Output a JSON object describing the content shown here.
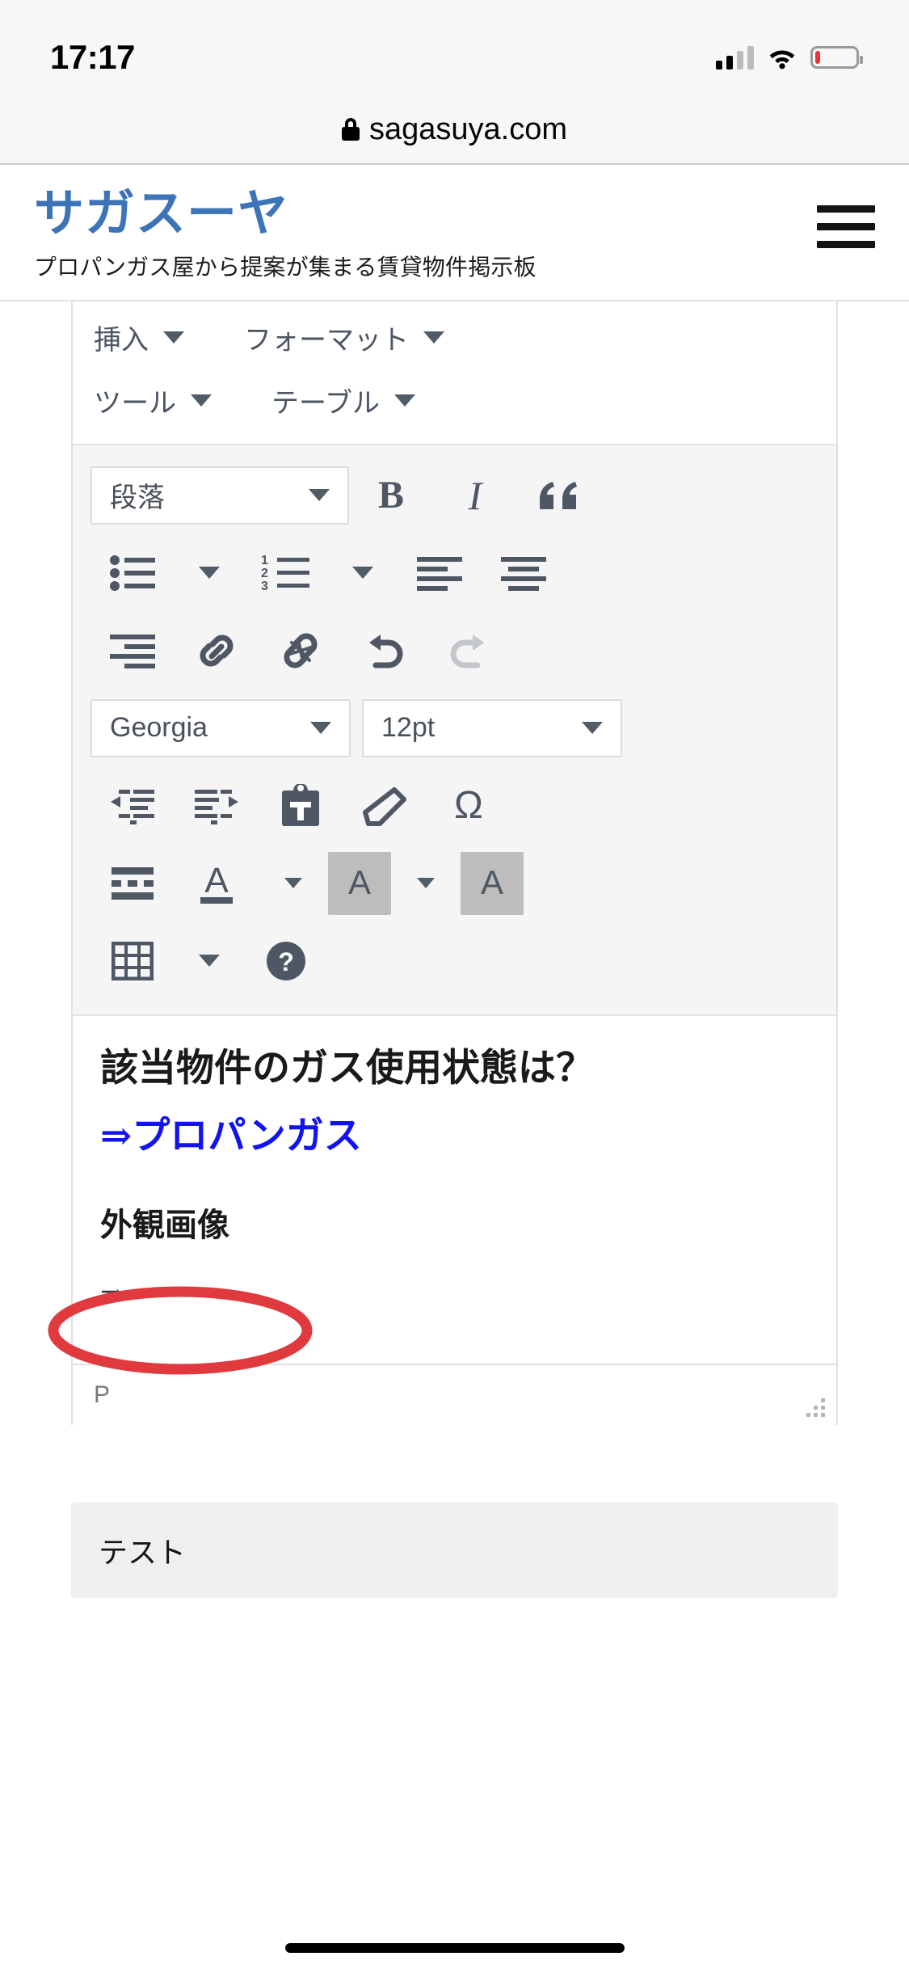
{
  "status_bar": {
    "time": "17:17",
    "signal_icon": "cellular-signal-icon",
    "wifi_icon": "wifi-icon",
    "battery_icon": "battery-low-icon",
    "battery_level_percent": 12
  },
  "browser": {
    "lock_icon": "lock-icon",
    "url": "sagasuya.com"
  },
  "site_header": {
    "brand_title": "サガスーヤ",
    "brand_subtitle": "プロパンガス屋から提案が集まる賃貸物件掲示板",
    "menu_icon": "hamburger-menu-icon",
    "brand_color": "#3d74b8"
  },
  "editor": {
    "menubar": [
      {
        "label": "挿入",
        "icon": "chevron-down-icon"
      },
      {
        "label": "フォーマット",
        "icon": "chevron-down-icon"
      },
      {
        "label": "ツール",
        "icon": "chevron-down-icon"
      },
      {
        "label": "テーブル",
        "icon": "chevron-down-icon"
      }
    ],
    "format_select": {
      "value": "段落",
      "icon": "chevron-down-icon"
    },
    "font_select": {
      "value": "Georgia",
      "icon": "chevron-down-icon"
    },
    "size_select": {
      "value": "12pt",
      "icon": "chevron-down-icon"
    },
    "buttons": {
      "bold": "B",
      "italic": "I",
      "blockquote": "❝",
      "bullet_list": "bullet-list-icon",
      "numbered_list": "numbered-list-icon",
      "align_left": "align-left-icon",
      "align_center": "align-center-icon",
      "align_right": "align-right-icon",
      "link": "link-icon",
      "unlink": "unlink-icon",
      "undo": "undo-icon",
      "redo": "redo-icon",
      "outdent": "outdent-icon",
      "indent": "indent-icon",
      "paste_as_text": "paste-as-text-icon",
      "clear_format": "eraser-icon",
      "special_char": "Ω",
      "horizontal_rule": "horizontal-rule-icon",
      "text_color": "A",
      "background_color": "A",
      "highlight_color": "A",
      "table": "table-icon",
      "help": "?"
    },
    "content": {
      "heading": "該当物件のガス使用状態は？",
      "link_line": "⇒プロパンガス",
      "subheading": "外観画像",
      "arrow_line": "⇒"
    },
    "statusbar": {
      "element_path": "P",
      "resize_handle": "resize-grip-icon"
    }
  },
  "annotation": {
    "ellipse_color": "#e0393e",
    "shape": "red-ellipse-highlight"
  },
  "bottom": {
    "label": "テスト"
  }
}
